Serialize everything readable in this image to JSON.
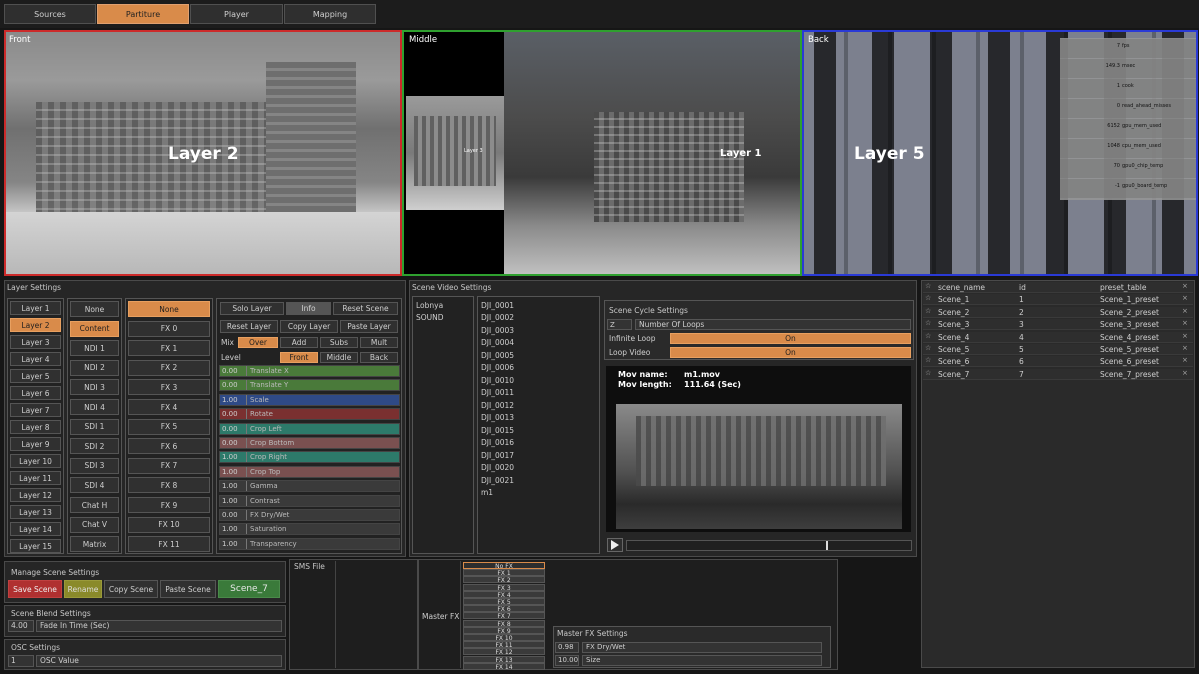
{
  "tabs": [
    "Sources",
    "Partiture",
    "Player",
    "Mapping"
  ],
  "viewports": {
    "front": {
      "label": "Front",
      "layer": "Layer 2"
    },
    "middle": {
      "label": "Middle",
      "layer": "Layer 1",
      "thumb_layer": "Layer 3"
    },
    "back": {
      "label": "Back",
      "layer": "Layer 5"
    }
  },
  "stats": [
    {
      "value": "7",
      "label": "fps"
    },
    {
      "value": "149.3",
      "label": "msec"
    },
    {
      "value": "1",
      "label": "cook"
    },
    {
      "value": "0",
      "label": "read_ahead_misses"
    },
    {
      "value": "6152",
      "label": "gpu_mem_used"
    },
    {
      "value": "1048",
      "label": "cpu_mem_used"
    },
    {
      "value": "70",
      "label": "gpu0_chip_temp"
    },
    {
      "value": "-1",
      "label": "gpu0_board_temp"
    }
  ],
  "layer_settings": {
    "title": "Layer Settings",
    "layers": [
      "Layer 1",
      "Layer 2",
      "Layer 3",
      "Layer 4",
      "Layer 5",
      "Layer 6",
      "Layer 7",
      "Layer 8",
      "Layer 9",
      "Layer 10",
      "Layer 11",
      "Layer 12",
      "Layer 13",
      "Layer 14",
      "Layer 15"
    ],
    "sources": [
      "None",
      "Content",
      "NDI 1",
      "NDI 2",
      "NDI 3",
      "NDI 4",
      "SDI 1",
      "SDI 2",
      "SDI 3",
      "SDI 4",
      "Chat H",
      "Chat V",
      "Matrix"
    ],
    "fx": [
      "None",
      "FX 0",
      "FX 1",
      "FX 2",
      "FX 3",
      "FX 4",
      "FX 5",
      "FX 6",
      "FX 7",
      "FX 8",
      "FX 9",
      "FX 10",
      "FX 11"
    ],
    "buttons": {
      "solo": "Solo Layer",
      "info": "Info",
      "reset_scene": "Reset Scene",
      "reset_layer": "Reset Layer",
      "copy_layer": "Copy Layer",
      "paste_layer": "Paste Layer"
    },
    "mix": {
      "label": "Mix",
      "options": [
        "Over",
        "Add",
        "Subs",
        "Mult"
      ]
    },
    "level": {
      "label": "Level",
      "options": [
        "Front",
        "Middle",
        "Back"
      ]
    },
    "params": [
      {
        "value": "0.00",
        "label": "Translate X",
        "color": "#4a7a3a"
      },
      {
        "value": "0.00",
        "label": "Translate Y",
        "color": "#4a7a3a"
      },
      {
        "value": "1.00",
        "label": "Scale",
        "color": "#2f4a86"
      },
      {
        "value": "0.00",
        "label": "Rotate",
        "color": "#7a3030"
      },
      {
        "value": "0.00",
        "label": "Crop Left",
        "color": "#2d7a6a"
      },
      {
        "value": "0.00",
        "label": "Crop Bottom",
        "color": "#7a5050"
      },
      {
        "value": "1.00",
        "label": "Crop Right",
        "color": "#2d7a6a"
      },
      {
        "value": "1.00",
        "label": "Crop Top",
        "color": "#7a5050"
      },
      {
        "value": "1.00",
        "label": "Gamma",
        "color": "#3a3a3a"
      },
      {
        "value": "1.00",
        "label": "Contrast",
        "color": "#3a3a3a"
      },
      {
        "value": "0.00",
        "label": "FX Dry/Wet",
        "color": "#3a3a3a"
      },
      {
        "value": "1.00",
        "label": "Saturation",
        "color": "#3a3a3a"
      },
      {
        "value": "1.00",
        "label": "Transparency",
        "color": "#3a3a3a"
      }
    ]
  },
  "scene_video": {
    "title": "Scene Video Settings",
    "folders": [
      "Lobnya",
      "SOUND"
    ],
    "files": [
      "DJI_0001",
      "DJI_0002",
      "DJI_0003",
      "DJI_0004",
      "DJI_0005",
      "DJI_0006",
      "DJI_0010",
      "DJI_0011",
      "DJI_0012",
      "DJI_0013",
      "DJI_0015",
      "DJI_0016",
      "DJI_0017",
      "DJI_0020",
      "DJI_0021",
      "m1"
    ],
    "cycle_title": "Scene Cycle Settings",
    "loops_value": "Z",
    "loops_label": "Number Of Loops",
    "infinite_label": "Infinite Loop",
    "infinite_value": "On",
    "loop_video_label": "Loop Video",
    "loop_video_value": "On",
    "mov_name_label": "Mov name:",
    "mov_name": "m1.mov",
    "mov_length_label": "Mov length:",
    "mov_length": "111.64 (Sec)",
    "playhead": 0.7
  },
  "scene_table": {
    "headers": [
      "scene_name",
      "id",
      "preset_table"
    ],
    "rows": [
      [
        "Scene_1",
        "1",
        "Scene_1_preset"
      ],
      [
        "Scene_2",
        "2",
        "Scene_2_preset"
      ],
      [
        "Scene_3",
        "3",
        "Scene_3_preset"
      ],
      [
        "Scene_4",
        "4",
        "Scene_4_preset"
      ],
      [
        "Scene_5",
        "5",
        "Scene_5_preset"
      ],
      [
        "Scene_6",
        "6",
        "Scene_6_preset"
      ],
      [
        "Scene_7",
        "7",
        "Scene_7_preset"
      ]
    ]
  },
  "manage": {
    "title": "Manage Scene Settings",
    "save": "Save Scene",
    "rename": "Rename",
    "copy": "Copy Scene",
    "paste": "Paste Scene",
    "current": "Scene_7"
  },
  "blend": {
    "title": "Scene Blend Settings",
    "value": "4.00",
    "label": "Fade In Time (Sec)"
  },
  "osc": {
    "title": "OSC Settings",
    "value": "1",
    "label": "OSC Value"
  },
  "sms": {
    "title": "SMS File"
  },
  "master_fx": {
    "title": "Master FX",
    "list": [
      "No FX",
      "FX 1",
      "FX 2",
      "FX 3",
      "FX 4",
      "FX 5",
      "FX 6",
      "FX 7",
      "FX 8",
      "FX 9",
      "FX 10",
      "FX 11",
      "FX 12",
      "FX 13",
      "FX 14"
    ],
    "settings_title": "Master FX Settings",
    "params": [
      {
        "value": "0.98",
        "label": "FX Dry/Wet"
      },
      {
        "value": "10.00",
        "label": "Size"
      }
    ]
  },
  "colors": {
    "accent": "#d98b4a",
    "front_border": "#cc2a2a",
    "middle_border": "#2fa02f",
    "back_border": "#2a3ad6"
  }
}
